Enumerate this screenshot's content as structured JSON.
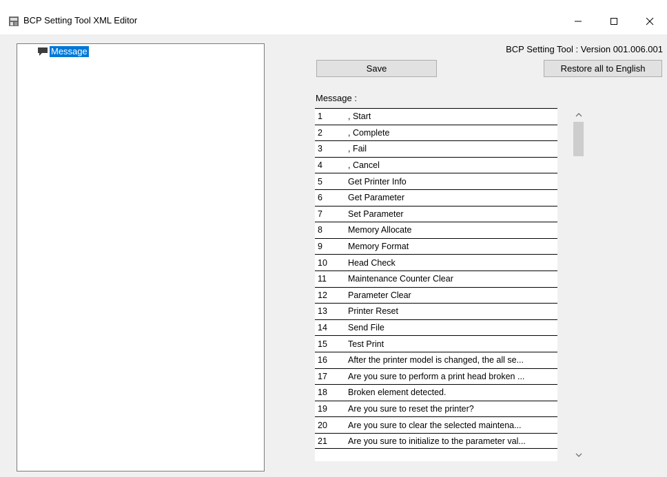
{
  "window": {
    "title": "BCP Setting Tool XML Editor",
    "controls": [
      "minimize",
      "maximize",
      "close"
    ]
  },
  "tree": {
    "nodes": [
      {
        "label": "Message",
        "icon": "speech-bubble-icon",
        "selected": true
      }
    ]
  },
  "header": {
    "version_text": "BCP Setting Tool :  Version 001.006.001"
  },
  "buttons": {
    "save": "Save",
    "restore": "Restore all to English"
  },
  "message_section": {
    "label": "Message :",
    "rows": [
      {
        "num": "1",
        "text": ", Start"
      },
      {
        "num": "2",
        "text": ", Complete"
      },
      {
        "num": "3",
        "text": ",  Fail"
      },
      {
        "num": "4",
        "text": ",  Cancel"
      },
      {
        "num": "5",
        "text": "Get Printer Info"
      },
      {
        "num": "6",
        "text": "Get Parameter"
      },
      {
        "num": "7",
        "text": "Set Parameter"
      },
      {
        "num": "8",
        "text": "Memory Allocate"
      },
      {
        "num": "9",
        "text": "Memory Format"
      },
      {
        "num": "10",
        "text": "Head Check"
      },
      {
        "num": "11",
        "text": "Maintenance Counter Clear"
      },
      {
        "num": "12",
        "text": "Parameter Clear"
      },
      {
        "num": "13",
        "text": "Printer Reset"
      },
      {
        "num": "14",
        "text": "Send File"
      },
      {
        "num": "15",
        "text": "Test Print"
      },
      {
        "num": "16",
        "text": "After the printer model is changed, the all se..."
      },
      {
        "num": "17",
        "text": "Are you sure to perform a print head broken ..."
      },
      {
        "num": "18",
        "text": "Broken element detected."
      },
      {
        "num": "19",
        "text": "Are you sure to reset the printer?"
      },
      {
        "num": "20",
        "text": "Are you sure to clear the selected maintena..."
      },
      {
        "num": "21",
        "text": "Are you sure to initialize to the parameter val..."
      }
    ]
  },
  "colors": {
    "selection": "#0078d7",
    "window_bg": "#f0f0f0"
  }
}
